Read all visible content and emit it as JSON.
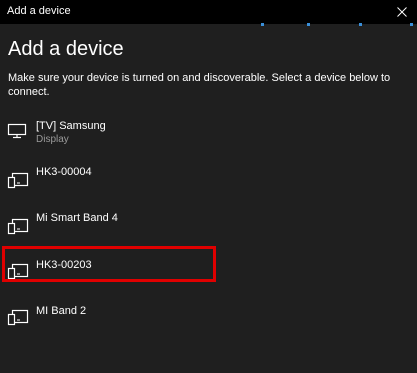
{
  "window": {
    "title": "Add a device",
    "close_glyph": "✕"
  },
  "heading": "Add a device",
  "description": "Make sure your device is turned on and discoverable. Select a device below to connect.",
  "devices": [
    {
      "name": "[TV] Samsung",
      "type": "Display",
      "icon": "monitor-icon"
    },
    {
      "name": "HK3-00004",
      "type": "",
      "icon": "phone-device-icon"
    },
    {
      "name": "Mi Smart Band 4",
      "type": "",
      "icon": "phone-device-icon"
    },
    {
      "name": "HK3-00203",
      "type": "",
      "icon": "phone-device-icon"
    },
    {
      "name": "MI Band 2",
      "type": "",
      "icon": "phone-device-icon"
    }
  ],
  "colors": {
    "background": "#1f1f1f",
    "titlebar": "#000000",
    "highlight": "#e00000",
    "accent_dots": "#3a8fd9"
  }
}
